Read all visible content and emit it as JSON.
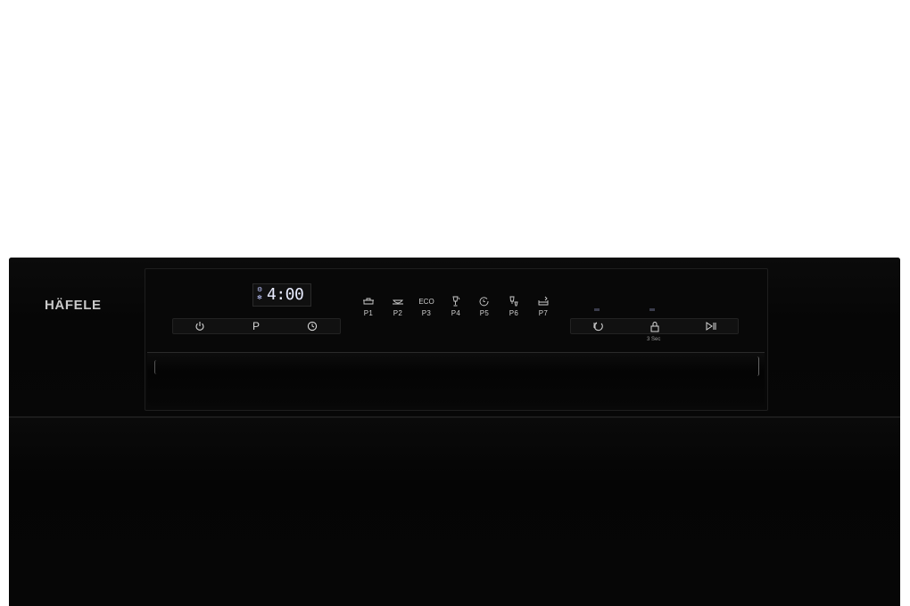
{
  "brand": "HÄFELE",
  "display": {
    "time": "4:00"
  },
  "left_controls": [
    {
      "name": "power-button",
      "icon": "power-icon"
    },
    {
      "name": "program-button",
      "icon": "program-p-icon",
      "label": "P"
    },
    {
      "name": "delay-timer-button",
      "icon": "clock-icon"
    }
  ],
  "programs": [
    {
      "label": "P1",
      "icon": "pot-icon"
    },
    {
      "label": "P2",
      "icon": "bowl-icon"
    },
    {
      "label": "P3",
      "icon": "eco-text",
      "text": "ECO"
    },
    {
      "label": "P4",
      "icon": "glass-icon"
    },
    {
      "label": "P5",
      "icon": "quick-wash-icon"
    },
    {
      "label": "P6",
      "icon": "glass-rinse-icon"
    },
    {
      "label": "P7",
      "icon": "tub-icon"
    }
  ],
  "right_controls": [
    {
      "name": "extra-function-button",
      "icon": "extra-function-icon"
    },
    {
      "name": "child-lock-button",
      "icon": "lock-icon",
      "hint": "3 Sec"
    },
    {
      "name": "start-pause-button",
      "icon": "play-pause-icon"
    }
  ],
  "colors": {
    "body": "#050505",
    "text": "#cfcfcf",
    "display": "#e9ecff"
  }
}
